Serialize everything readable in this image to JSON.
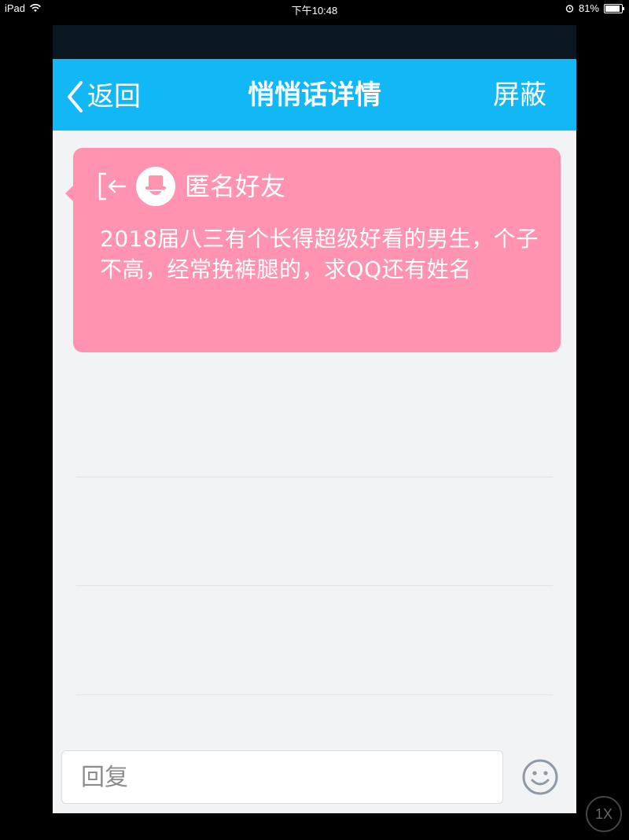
{
  "status_bar": {
    "device": "iPad",
    "time": "下午10:48",
    "battery": "81%",
    "battery_level": 0.81,
    "icons": [
      "wifi-icon",
      "alarm-icon",
      "battery-icon"
    ]
  },
  "nav": {
    "back_label": "返回",
    "title": "悄悄话详情",
    "block_label": "屏蔽"
  },
  "message": {
    "sender": "匿名好友",
    "text": "2018届八三有个长得超级好看的男生，个子不高，经常挽裤腿的，求QQ还有姓名",
    "bubble_color": "#ff93b0"
  },
  "input": {
    "placeholder": "回复",
    "emoji_icon": "smiley-icon"
  },
  "zoom": {
    "label": "1X"
  },
  "colors": {
    "accent": "#12b7f5",
    "background": "#f2f3f5"
  }
}
